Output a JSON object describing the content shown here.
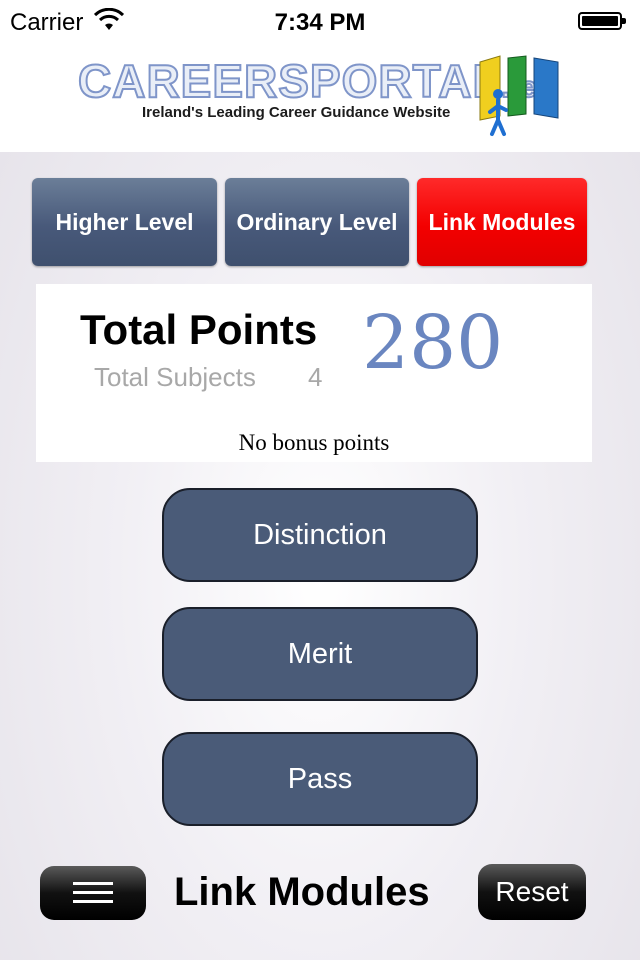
{
  "status_bar": {
    "carrier": "Carrier",
    "time": "7:34 PM",
    "battery_level": 1.0
  },
  "header": {
    "logo_main": "CAREERSPORTAL",
    "logo_suffix": ".ie",
    "tagline": "Ireland's Leading Career Guidance Website"
  },
  "tabs": [
    {
      "label": "Higher Level",
      "active": false
    },
    {
      "label": "Ordinary Level",
      "active": false
    },
    {
      "label": "Link Modules",
      "active": true
    }
  ],
  "summary": {
    "title": "Total Points",
    "subjects_label": "Total Subjects",
    "subjects_count": "4",
    "points": "280",
    "bonus_text": "No bonus points"
  },
  "grades": [
    {
      "label": "Distinction"
    },
    {
      "label": "Merit"
    },
    {
      "label": "Pass"
    }
  ],
  "footer": {
    "menu_icon": "hamburger-icon",
    "title": "Link Modules",
    "reset_label": "Reset"
  },
  "colors": {
    "tab_slate": "#48597a",
    "tab_active": "#f30000",
    "grade_button": "#4a5b78",
    "points_text": "#6a86c0"
  }
}
